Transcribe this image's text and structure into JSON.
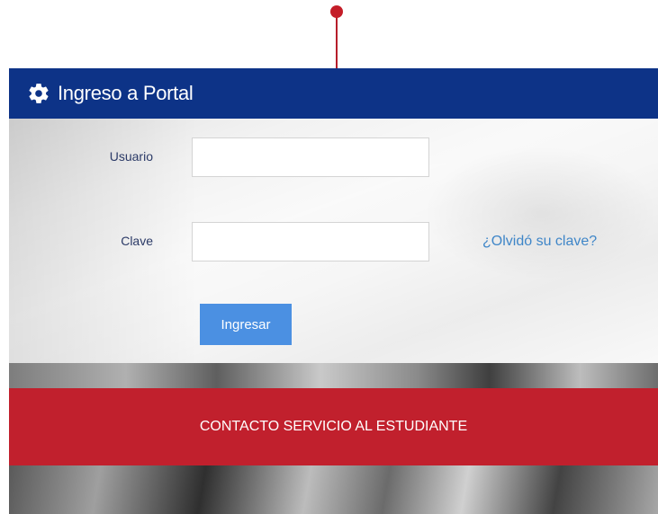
{
  "header": {
    "title": "Ingreso a Portal",
    "icon": "gear-icon"
  },
  "form": {
    "user_label": "Usuario",
    "user_value": "",
    "password_label": "Clave",
    "password_value": "",
    "forgot_link": "¿Olvidó su clave?",
    "submit_label": "Ingresar"
  },
  "contact": {
    "label": "CONTACTO SERVICIO AL ESTUDIANTE"
  },
  "colors": {
    "header_bg": "#0d3387",
    "contact_bg": "#c1202d",
    "button_bg": "#4b90e2",
    "link": "#3f86c8",
    "pin": "#c41d28"
  }
}
